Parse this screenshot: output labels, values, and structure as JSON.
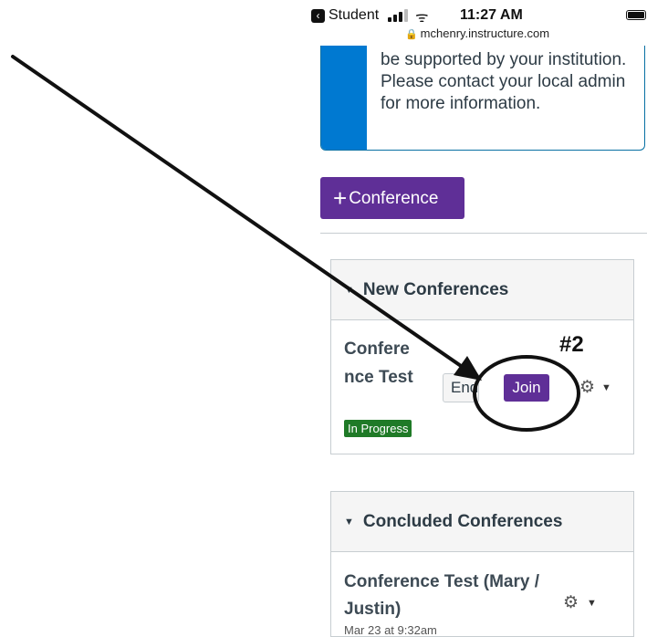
{
  "status_bar": {
    "back_app": "Student",
    "time": "11:27 AM",
    "url": "mchenry.instructure.com"
  },
  "notice": {
    "text": "be supported by your institution. Please contact your local admin for more information."
  },
  "add_conference_button": "Conference",
  "new_conferences": {
    "header": "New Conferences",
    "item": {
      "title": "Confere nce Test",
      "status": "In Progress",
      "end_label": "End",
      "join_label": "Join"
    }
  },
  "concluded_conferences": {
    "header": "Concluded Conferences",
    "item": {
      "title": "Conference Test (Mary / Justin)",
      "date": "Mar 23 at 9:32am"
    }
  },
  "annotation": {
    "label": "#2"
  },
  "colors": {
    "primary_button": "#5f2f97",
    "info_bar": "#0079d1",
    "in_progress": "#1f7a27"
  }
}
